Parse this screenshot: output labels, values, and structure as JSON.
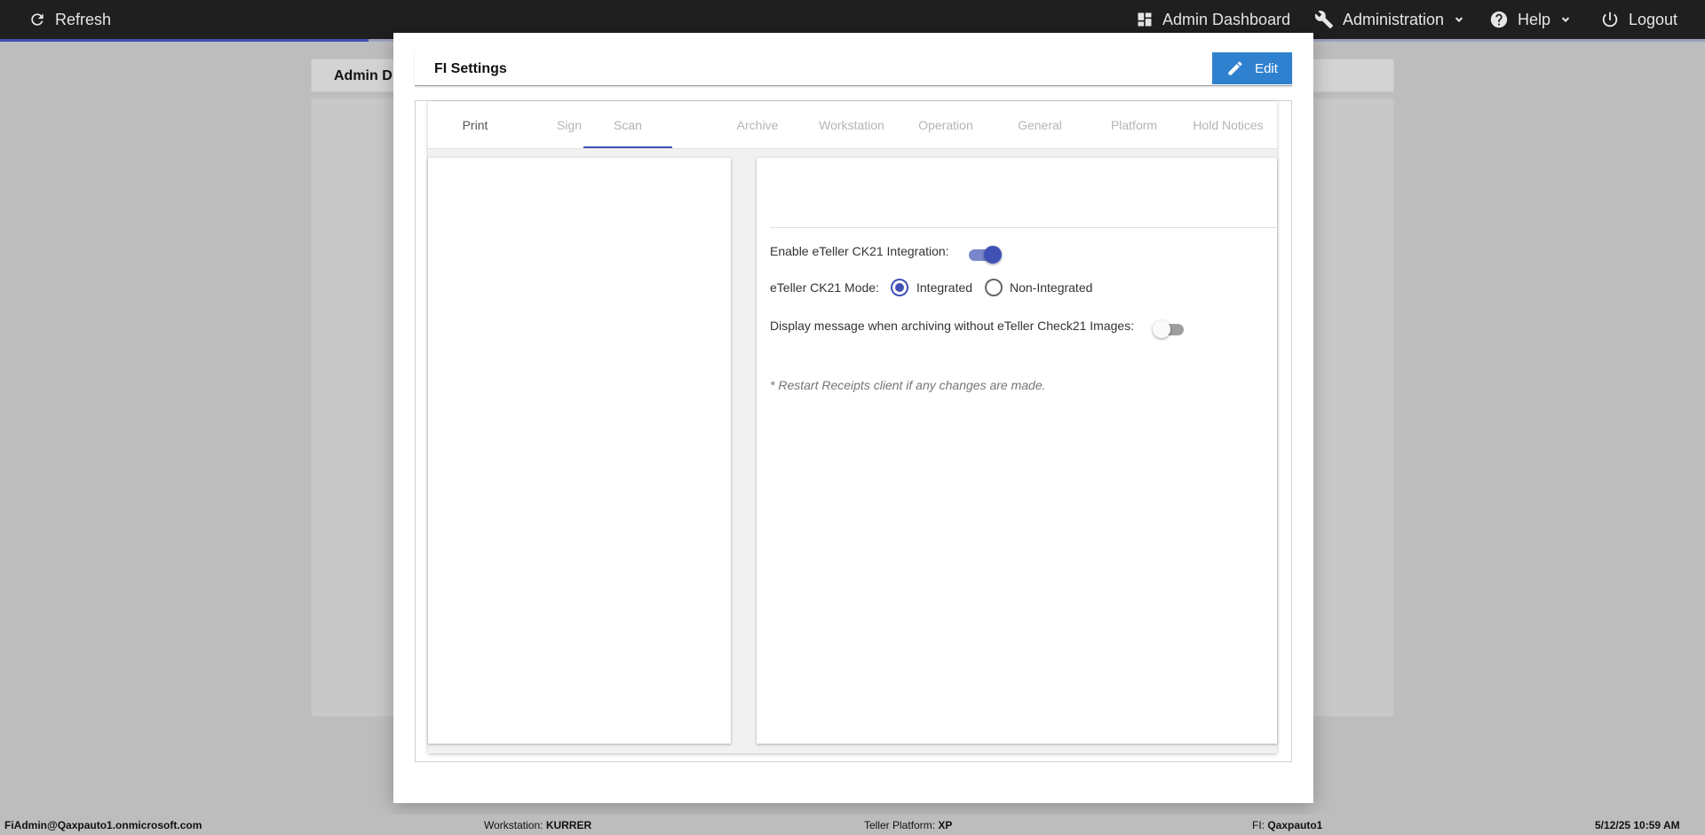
{
  "topbar": {
    "refresh_label": "Refresh",
    "admin_dashboard_label": "Admin Dashboard",
    "administration_label": "Administration",
    "help_label": "Help",
    "logout_label": "Logout"
  },
  "background": {
    "card_title": "Admin D"
  },
  "modal": {
    "title": "FI Settings",
    "edit_label": "Edit",
    "tabs": [
      {
        "label": "Print"
      },
      {
        "label": "Sign"
      },
      {
        "label": "Scan"
      },
      {
        "label": "Archive"
      },
      {
        "label": "Workstation"
      },
      {
        "label": "Operation"
      },
      {
        "label": "General"
      },
      {
        "label": "Platform"
      },
      {
        "label": "Hold Notices"
      }
    ],
    "active_tab": "Scan",
    "settings": {
      "enable_integration_label": "Enable eTeller CK21 Integration:",
      "enable_integration_on": true,
      "mode_label": "eTeller CK21 Mode:",
      "mode_options": [
        "Integrated",
        "Non-Integrated"
      ],
      "mode_selected": "Integrated",
      "display_message_label": "Display message when archiving without eTeller Check21 Images:",
      "display_message_on": false,
      "restart_note": "* Restart Receipts client if any changes are made."
    }
  },
  "statusbar": {
    "user": "FiAdmin@Qaxpauto1.onmicrosoft.com",
    "workstation_label": "Workstation: ",
    "workstation_value": "KURRER",
    "platform_label": "Teller Platform: ",
    "platform_value": "XP",
    "fi_label": "FI: ",
    "fi_value": "Qaxpauto1",
    "datetime": "5/12/25 10:59 AM"
  },
  "colors": {
    "accent": "#3f51b5",
    "edit_button": "#2f80cf",
    "topbar_bg": "#1f1f1f"
  }
}
